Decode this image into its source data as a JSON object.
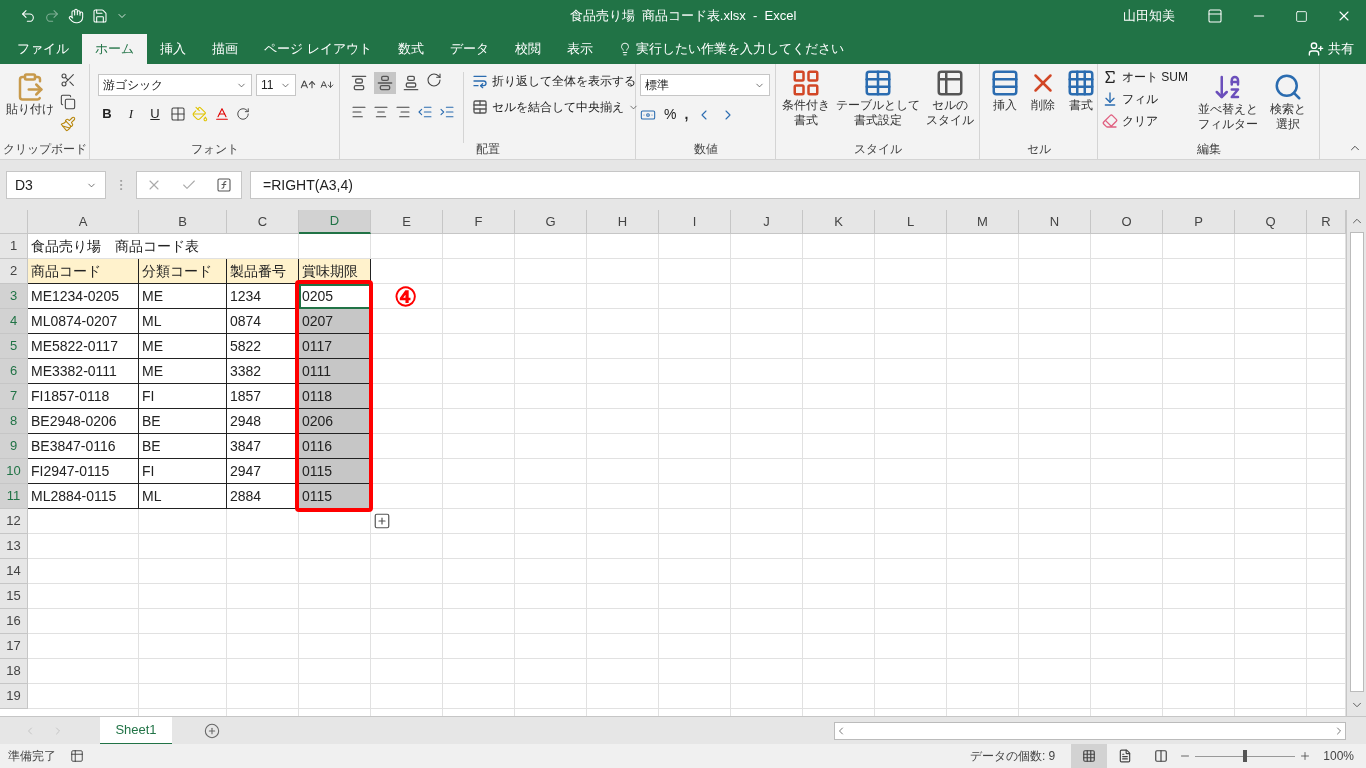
{
  "title_bar": {
    "title": "食品売り場  商品コード表.xlsx  -  Excel",
    "user": "山田知美"
  },
  "tabs": [
    {
      "label": "ファイル",
      "selected": false
    },
    {
      "label": "ホーム",
      "selected": true
    },
    {
      "label": "挿入",
      "selected": false
    },
    {
      "label": "描画",
      "selected": false
    },
    {
      "label": "ページ レイアウト",
      "selected": false
    },
    {
      "label": "数式",
      "selected": false
    },
    {
      "label": "データ",
      "selected": false
    },
    {
      "label": "校閲",
      "selected": false
    },
    {
      "label": "表示",
      "selected": false
    }
  ],
  "tell_me": "実行したい作業を入力してください",
  "share": "共有",
  "ribbon": {
    "clipboard": {
      "label": "クリップボード",
      "paste": "貼り付け"
    },
    "font": {
      "label": "フォント",
      "font_name": "游ゴシック",
      "font_size": "11",
      "bold": "B",
      "italic": "I",
      "underline": "U"
    },
    "alignment": {
      "label": "配置",
      "wrap_text": "折り返して全体を表示する",
      "merge_center": "セルを結合して中央揃え",
      "vertical_align": [
        {
          "kind": "top",
          "selected": false
        },
        {
          "kind": "middle",
          "selected": true
        },
        {
          "kind": "bottom",
          "selected": false
        }
      ]
    },
    "number": {
      "label": "数値",
      "format": "標準",
      "percent": "%",
      "comma": ","
    },
    "styles": {
      "label": "スタイル",
      "buttons": [
        [
          "条件付き",
          "書式"
        ],
        [
          "テーブルとして",
          "書式設定"
        ],
        [
          "セルの",
          "スタイル"
        ]
      ]
    },
    "cells": {
      "label": "セル",
      "buttons": [
        "挿入",
        "削除",
        "書式"
      ]
    },
    "editing": {
      "label": "編集",
      "autosum": "オート SUM",
      "fill": "フィル",
      "clear": "クリア",
      "sort_filter": [
        "並べ替えと",
        "フィルター"
      ],
      "find_select": [
        "検索と",
        "選択"
      ]
    }
  },
  "formula_bar": {
    "name_box": "D3",
    "formula": "=RIGHT(A3,4)"
  },
  "columns": [
    {
      "label": "A",
      "selected": false
    },
    {
      "label": "B",
      "selected": false
    },
    {
      "label": "C",
      "selected": false
    },
    {
      "label": "D",
      "selected": true
    },
    {
      "label": "E",
      "selected": false
    },
    {
      "label": "F",
      "selected": false
    },
    {
      "label": "G",
      "selected": false
    },
    {
      "label": "H",
      "selected": false
    },
    {
      "label": "I",
      "selected": false
    },
    {
      "label": "J",
      "selected": false
    },
    {
      "label": "K",
      "selected": false
    },
    {
      "label": "L",
      "selected": false
    },
    {
      "label": "M",
      "selected": false
    },
    {
      "label": "N",
      "selected": false
    },
    {
      "label": "O",
      "selected": false
    },
    {
      "label": "P",
      "selected": false
    },
    {
      "label": "Q",
      "selected": false
    },
    {
      "label": "R",
      "selected": false
    }
  ],
  "rows": [
    {
      "label": "1",
      "selected": false,
      "cells": [
        {
          "kind": "title",
          "text": "食品売り場　商品コード表",
          "selected": false,
          "active": false
        }
      ]
    },
    {
      "label": "2",
      "selected": false,
      "cells": [
        {
          "kind": "header",
          "text": "商品コード",
          "selected": false,
          "active": false
        },
        {
          "kind": "header",
          "text": "分類コード",
          "selected": false,
          "active": false
        },
        {
          "kind": "header",
          "text": "製品番号",
          "selected": false,
          "active": false
        },
        {
          "kind": "header",
          "text": "賞味期限",
          "selected": false,
          "active": false
        }
      ]
    },
    {
      "label": "3",
      "selected": true,
      "cells": [
        {
          "kind": "data",
          "text": "ME1234-0205",
          "selected": false,
          "active": false
        },
        {
          "kind": "data",
          "text": "ME",
          "selected": false,
          "active": false
        },
        {
          "kind": "data",
          "text": "1234",
          "selected": false,
          "active": false
        },
        {
          "kind": "data",
          "text": "0205",
          "selected": true,
          "active": true
        }
      ]
    },
    {
      "label": "4",
      "selected": true,
      "cells": [
        {
          "kind": "data",
          "text": "ML0874-0207",
          "selected": false,
          "active": false
        },
        {
          "kind": "data",
          "text": "ML",
          "selected": false,
          "active": false
        },
        {
          "kind": "data",
          "text": "0874",
          "selected": false,
          "active": false
        },
        {
          "kind": "data",
          "text": "0207",
          "selected": true,
          "active": false
        }
      ]
    },
    {
      "label": "5",
      "selected": true,
      "cells": [
        {
          "kind": "data",
          "text": "ME5822-0117",
          "selected": false,
          "active": false
        },
        {
          "kind": "data",
          "text": "ME",
          "selected": false,
          "active": false
        },
        {
          "kind": "data",
          "text": "5822",
          "selected": false,
          "active": false
        },
        {
          "kind": "data",
          "text": "0117",
          "selected": true,
          "active": false
        }
      ]
    },
    {
      "label": "6",
      "selected": true,
      "cells": [
        {
          "kind": "data",
          "text": "ME3382-0111",
          "selected": false,
          "active": false
        },
        {
          "kind": "data",
          "text": "ME",
          "selected": false,
          "active": false
        },
        {
          "kind": "data",
          "text": "3382",
          "selected": false,
          "active": false
        },
        {
          "kind": "data",
          "text": "0111",
          "selected": true,
          "active": false
        }
      ]
    },
    {
      "label": "7",
      "selected": true,
      "cells": [
        {
          "kind": "data",
          "text": "FI1857-0118",
          "selected": false,
          "active": false
        },
        {
          "kind": "data",
          "text": "FI",
          "selected": false,
          "active": false
        },
        {
          "kind": "data",
          "text": "1857",
          "selected": false,
          "active": false
        },
        {
          "kind": "data",
          "text": "0118",
          "selected": true,
          "active": false
        }
      ]
    },
    {
      "label": "8",
      "selected": true,
      "cells": [
        {
          "kind": "data",
          "text": "BE2948-0206",
          "selected": false,
          "active": false
        },
        {
          "kind": "data",
          "text": "BE",
          "selected": false,
          "active": false
        },
        {
          "kind": "data",
          "text": "2948",
          "selected": false,
          "active": false
        },
        {
          "kind": "data",
          "text": "0206",
          "selected": true,
          "active": false
        }
      ]
    },
    {
      "label": "9",
      "selected": true,
      "cells": [
        {
          "kind": "data",
          "text": "BE3847-0116",
          "selected": false,
          "active": false
        },
        {
          "kind": "data",
          "text": "BE",
          "selected": false,
          "active": false
        },
        {
          "kind": "data",
          "text": "3847",
          "selected": false,
          "active": false
        },
        {
          "kind": "data",
          "text": "0116",
          "selected": true,
          "active": false
        }
      ]
    },
    {
      "label": "10",
      "selected": true,
      "cells": [
        {
          "kind": "data",
          "text": "FI2947-0115",
          "selected": false,
          "active": false
        },
        {
          "kind": "data",
          "text": "FI",
          "selected": false,
          "active": false
        },
        {
          "kind": "data",
          "text": "2947",
          "selected": false,
          "active": false
        },
        {
          "kind": "data",
          "text": "0115",
          "selected": true,
          "active": false
        }
      ]
    },
    {
      "label": "11",
      "selected": true,
      "cells": [
        {
          "kind": "data",
          "text": "ML2884-0115",
          "selected": false,
          "active": false
        },
        {
          "kind": "data",
          "text": "ML",
          "selected": false,
          "active": false
        },
        {
          "kind": "data",
          "text": "2884",
          "selected": false,
          "active": false
        },
        {
          "kind": "data",
          "text": "0115",
          "selected": true,
          "active": false
        }
      ]
    },
    {
      "label": "12",
      "selected": false
    },
    {
      "label": "13",
      "selected": false
    },
    {
      "label": "14",
      "selected": false
    },
    {
      "label": "15",
      "selected": false
    },
    {
      "label": "16",
      "selected": false
    },
    {
      "label": "17",
      "selected": false
    },
    {
      "label": "18",
      "selected": false
    },
    {
      "label": "19",
      "selected": false
    }
  ],
  "annotation": {
    "marker": "④"
  },
  "sheet_tabs": [
    {
      "label": "Sheet1",
      "selected": true
    }
  ],
  "status_bar": {
    "status": "準備完了",
    "count": "データの個数: 9",
    "views": [
      {
        "kind": "normal",
        "selected": true
      },
      {
        "kind": "page_layout",
        "selected": false
      },
      {
        "kind": "page_break",
        "selected": false
      }
    ],
    "zoom_slider": {
      "level": 0.5
    },
    "zoom": "100%"
  }
}
